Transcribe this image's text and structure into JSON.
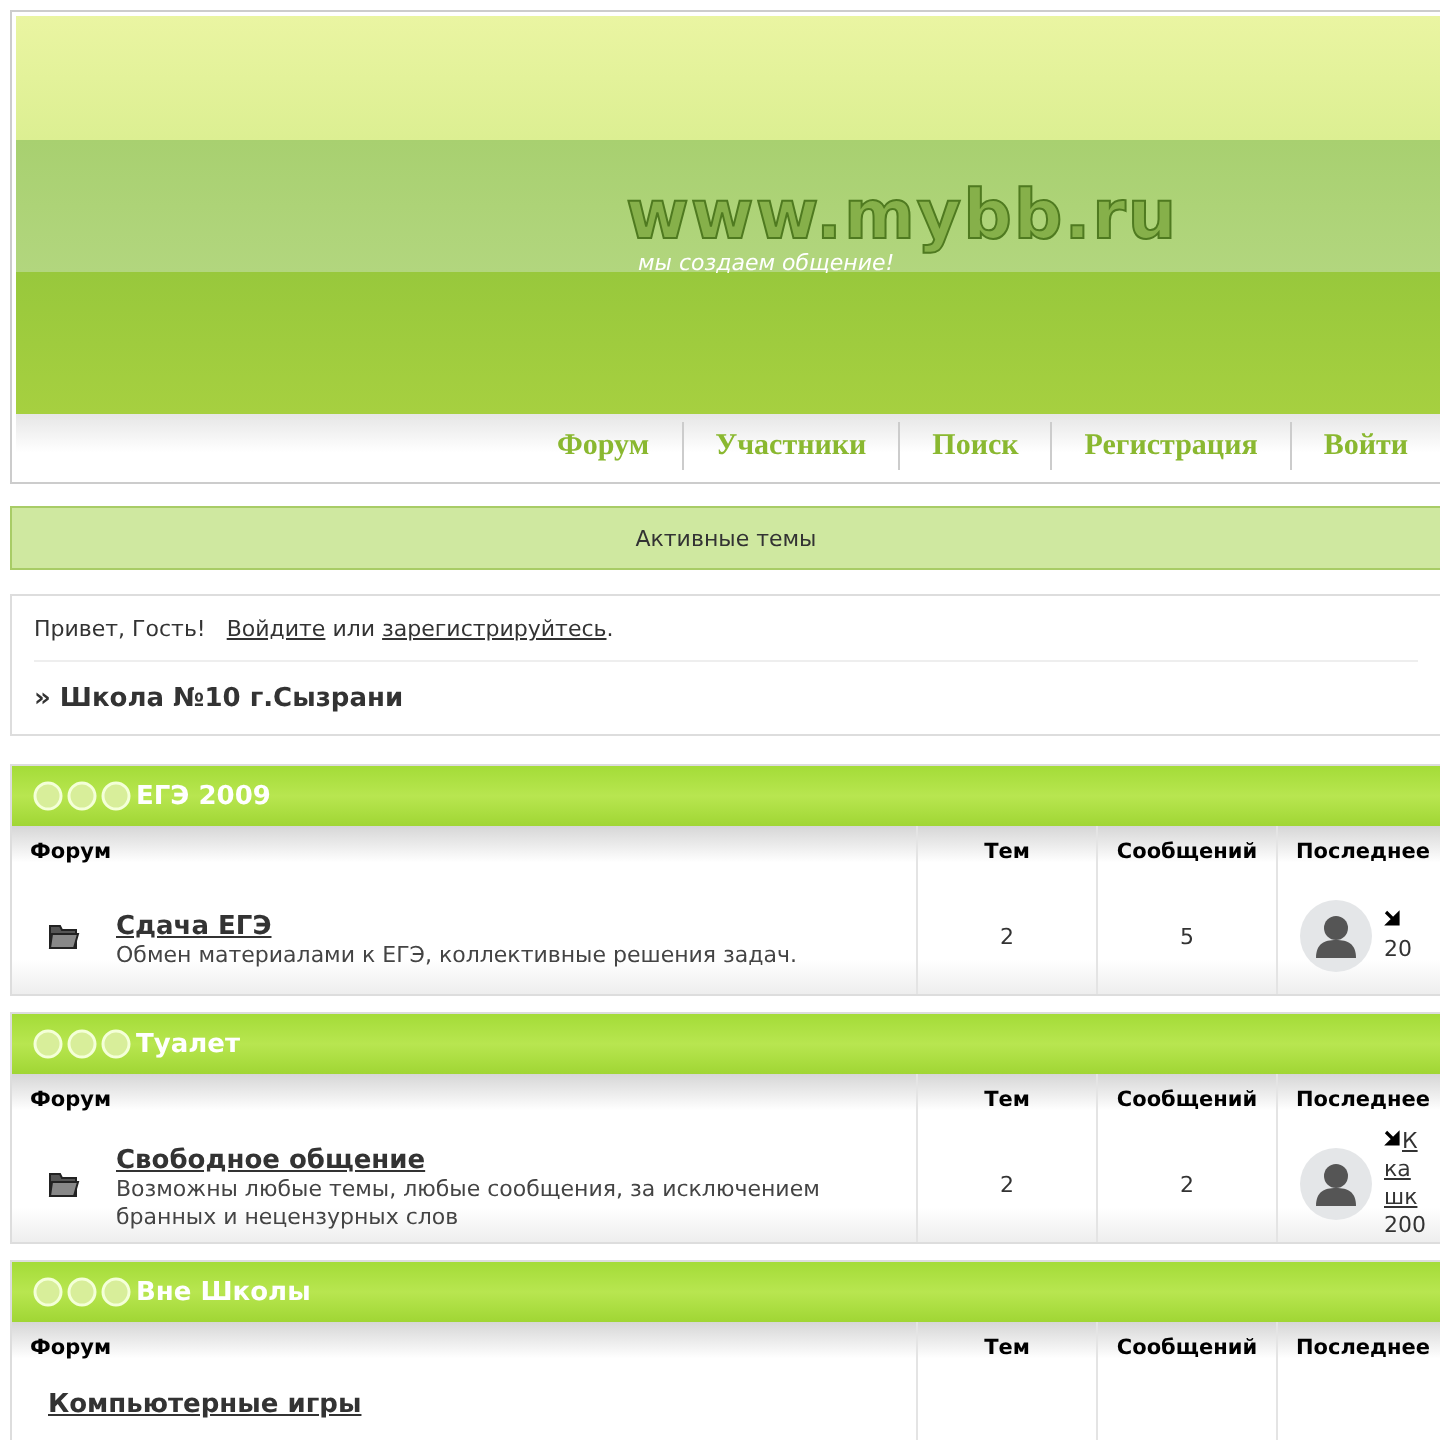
{
  "header": {
    "logo": "www.mybb.ru",
    "slogan": "мы создаем общение!"
  },
  "nav": [
    {
      "label": "Форум"
    },
    {
      "label": "Участники"
    },
    {
      "label": "Поиск"
    },
    {
      "label": "Регистрация"
    },
    {
      "label": "Войти"
    }
  ],
  "active_topics": "Активные темы",
  "welcome": {
    "greeting": "Привет, Гость!",
    "login_link": "Войдите",
    "or": "или",
    "register_link": "зарегистрируйтесь",
    "end": "."
  },
  "breadcrumb": "» Школа №10 г.Сызрани",
  "categories": [
    {
      "title": "ЕГЭ 2009",
      "columns": [
        "Форум",
        "Тем",
        "Сообщений",
        "Последнее"
      ],
      "forums": [
        {
          "name": "Сдача ЕГЭ",
          "description": "Обмен материалами к ЕГЭ, коллективные решения задач.",
          "topics": "2",
          "posts": "5",
          "last_post_date": "20"
        }
      ]
    },
    {
      "title": "Туалет",
      "columns": [
        "Форум",
        "Тем",
        "Сообщений",
        "Последнее"
      ],
      "forums": [
        {
          "name": "Свободное общение",
          "description": "Возможны любые темы, любые сообщения, за исключением бранных и нецензурных слов",
          "topics": "2",
          "posts": "2",
          "last_post_link": [
            "К",
            "ка",
            "шк"
          ],
          "last_post_date": "200"
        }
      ]
    },
    {
      "title": "Вне Школы",
      "columns": [
        "Форум",
        "Тем",
        "Сообщений",
        "Последнее"
      ],
      "forums": [
        {
          "name": "Компьютерные игры"
        }
      ]
    }
  ]
}
